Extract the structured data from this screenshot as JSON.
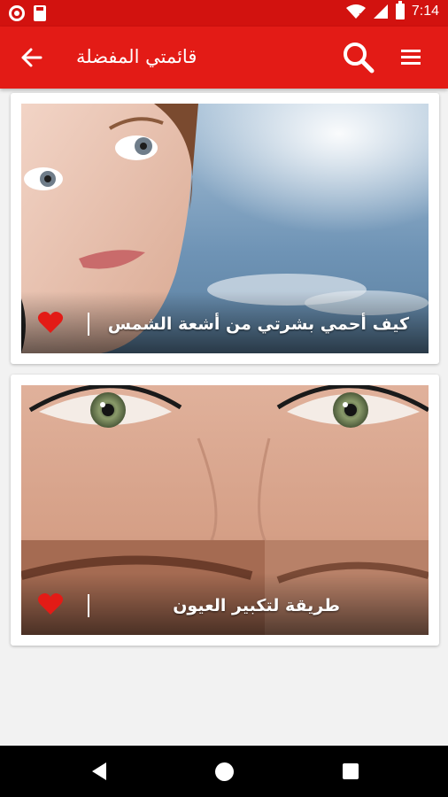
{
  "status_bar": {
    "time": "7:14",
    "icons": [
      "record-icon",
      "sd-card-icon",
      "wifi-icon",
      "signal-icon",
      "battery-icon"
    ]
  },
  "app_bar": {
    "title": "قائمتي المفضلة",
    "icons": [
      "back-arrow-icon",
      "search-icon",
      "menu-icon"
    ],
    "color": "#e31b16"
  },
  "favorites": [
    {
      "title": "كيف أحمي بشرتي من أشعة الشمس",
      "image": "woman-face-sky",
      "favorited": true
    },
    {
      "title": "طريقة لتكبير العيون",
      "image": "green-eyes-closeup",
      "favorited": true
    }
  ],
  "colors": {
    "status_bar": "#d2120f",
    "heart": "#e31b16",
    "background": "#f2f2f2"
  },
  "nav_bar": {
    "icons": [
      "nav-back-icon",
      "nav-home-icon",
      "nav-recents-icon"
    ]
  }
}
